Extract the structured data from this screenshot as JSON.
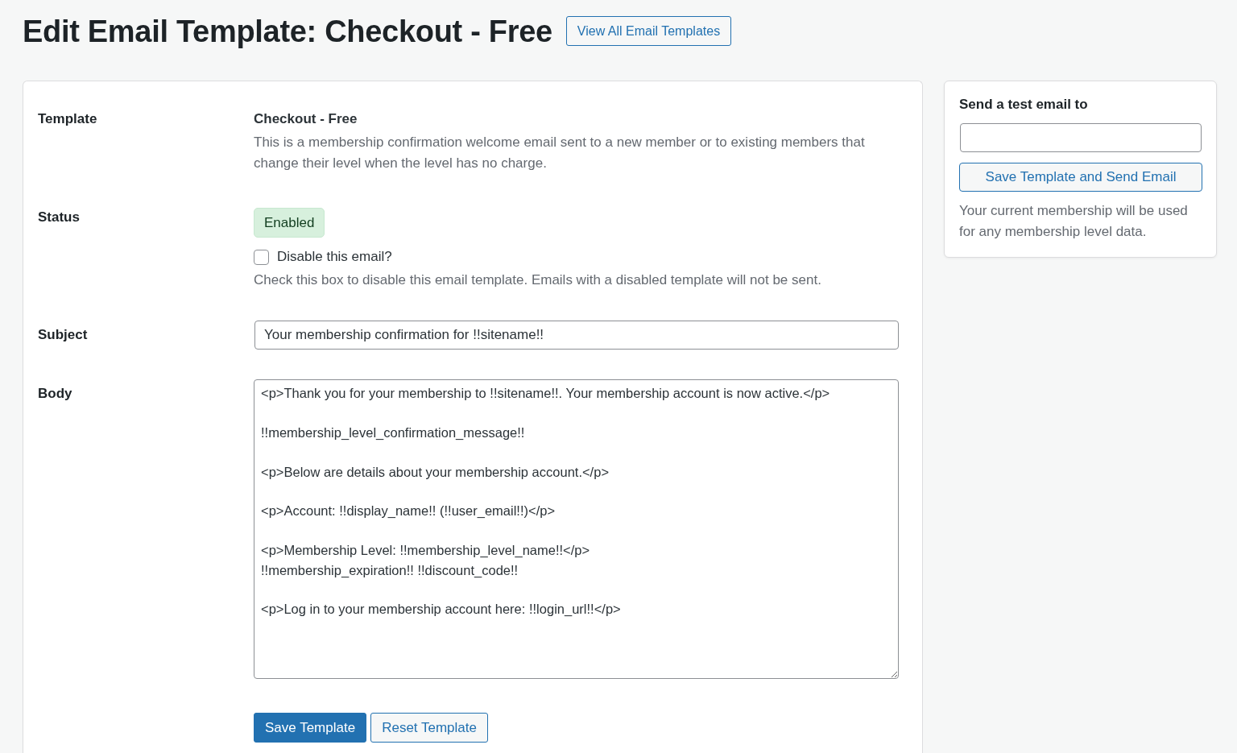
{
  "page_title": "Edit Email Template: Checkout - Free",
  "view_all_button": "View All Email Templates",
  "template": {
    "label": "Template",
    "name": "Checkout - Free",
    "description": "This is a membership confirmation welcome email sent to a new member or to existing members that change their level when the level has no charge."
  },
  "status": {
    "label": "Status",
    "badge": "Enabled",
    "enabled": true,
    "disable_checkbox": {
      "label": "Disable this email?",
      "checked": false
    },
    "help": "Check this box to disable this email template. Emails with a disabled template will not be sent."
  },
  "subject": {
    "label": "Subject",
    "value": "Your membership confirmation for !!sitename!!"
  },
  "body": {
    "label": "Body",
    "value": "<p>Thank you for your membership to !!sitename!!. Your membership account is now active.</p>\n\n!!membership_level_confirmation_message!!\n\n<p>Below are details about your membership account.</p>\n\n<p>Account: !!display_name!! (!!user_email!!)</p>\n\n<p>Membership Level: !!membership_level_name!!</p>\n!!membership_expiration!! !!discount_code!!\n\n<p>Log in to your membership account here: !!login_url!!</p>"
  },
  "buttons": [
    {
      "label": "Save Template",
      "kind": "save"
    },
    {
      "label": "Reset Template",
      "kind": "reset"
    }
  ],
  "test_email": {
    "title": "Send a test email to",
    "button": "Save Template and Send Email",
    "note": "Your current membership will be used for any membership level data."
  }
}
